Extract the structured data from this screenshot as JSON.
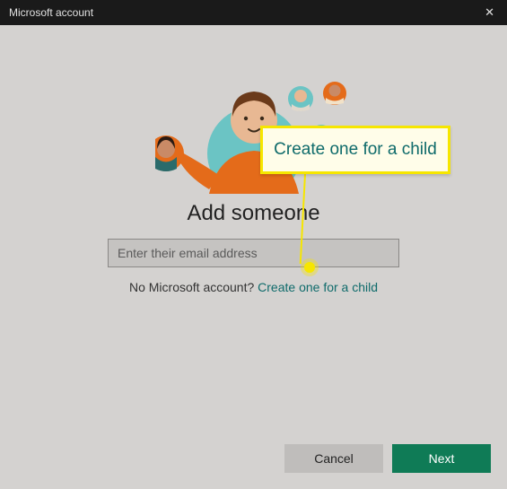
{
  "titlebar": {
    "title": "Microsoft account"
  },
  "heading": "Add someone",
  "email": {
    "placeholder": "Enter their email address",
    "value": ""
  },
  "subline": {
    "prefix": "No Microsoft account? ",
    "link": "Create one for a child"
  },
  "buttons": {
    "cancel": "Cancel",
    "next": "Next"
  },
  "callout": {
    "text": "Create one for a child"
  },
  "colors": {
    "accent": "#0f7b56",
    "link": "#0f6b6b",
    "highlight": "#f6e600"
  }
}
